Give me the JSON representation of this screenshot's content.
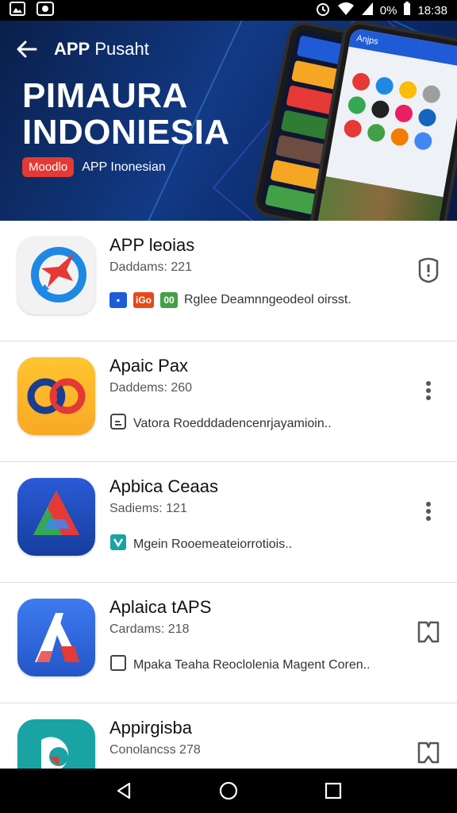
{
  "status_bar": {
    "battery_percent": "0%",
    "time": "18:38",
    "icons": [
      "image-icon",
      "face-icon",
      "alarm-icon",
      "wifi-icon",
      "signal-icon",
      "battery-icon"
    ]
  },
  "header": {
    "title_bold": "APP",
    "title_rest": "Pusaht",
    "hero_title_line1": "PIMAURA",
    "hero_title_line2": "INDONIESIA",
    "hero_badge": "Moodlo",
    "hero_subtitle": "APP Inonesian",
    "phone_header": "Anjps"
  },
  "apps": [
    {
      "name": "APP leoias",
      "meta": "Daddams: 221",
      "desc": "Rglee Deamnngeodeol oirsst.",
      "icon": "star-bubble-icon",
      "action_icon": "shield-icon",
      "tags": [
        {
          "text": "▪",
          "color": "#1e5bd6"
        },
        {
          "text": "iGo",
          "color": "#e64a19"
        },
        {
          "text": "00",
          "color": "#43a047"
        }
      ]
    },
    {
      "name": "Apaic Pax",
      "meta": "Daddems: 260",
      "desc": "Vatora Roedddadencenrjayamioin..",
      "icon": "infinity-icon",
      "action_icon": "more-vertical-icon",
      "tags": [
        {
          "text": "",
          "color": "outline"
        }
      ]
    },
    {
      "name": "Apbica Ceaas",
      "meta": "Sadiems: 121",
      "desc": "Mgein Rooemeateiorrotiois..",
      "icon": "triangle-icon",
      "action_icon": "more-vertical-icon",
      "tags": [
        {
          "text": "",
          "color": "#1aa3a3"
        }
      ]
    },
    {
      "name": "Aplaica tAPS",
      "meta": "Cardams: 218",
      "desc": "Mpaka Teaha Reoclolenia Magent Coren..",
      "icon": "letter-a-icon",
      "action_icon": "bookmark-outline-icon",
      "tags": [
        {
          "text": "",
          "color": "outline"
        }
      ]
    },
    {
      "name": "Appirgisba",
      "meta": "Conolancss 278",
      "desc": "",
      "icon": "pie-chart-icon",
      "action_icon": "bookmark-outline-icon",
      "tags": []
    }
  ],
  "nav": {
    "icons": [
      "back-triangle-icon",
      "home-circle-icon",
      "recents-square-icon"
    ]
  }
}
